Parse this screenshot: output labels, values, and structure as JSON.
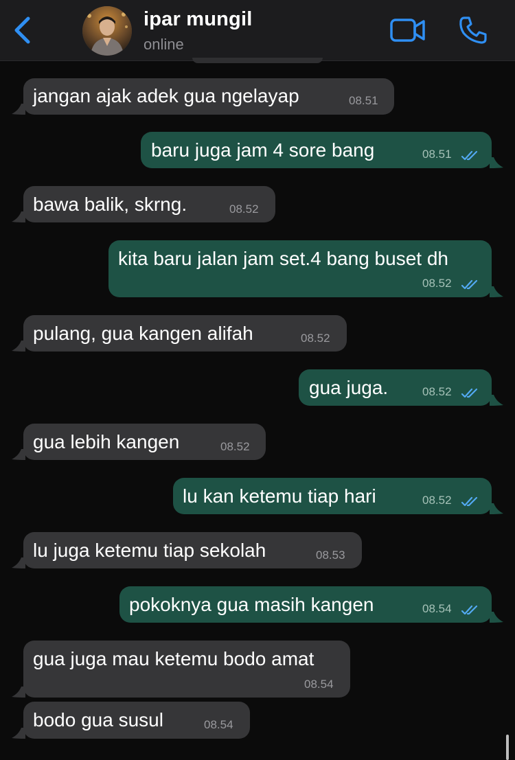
{
  "header": {
    "contact_name": "ipar mungil",
    "status": "online"
  },
  "colors": {
    "accent": "#2f8ff3",
    "incoming_bubble": "#363638",
    "outgoing_bubble": "#1e5245",
    "read_ticks": "#53a9f2"
  },
  "icons": {
    "back": "chevron-left-icon",
    "video": "video-camera-icon",
    "call": "phone-icon",
    "read": "double-check-icon"
  },
  "messages": [
    {
      "direction": "in",
      "text": "jangan ajak adek gua ngelayap",
      "time": "08.51"
    },
    {
      "direction": "out",
      "text": "baru juga jam 4 sore bang",
      "time": "08.51",
      "read": true
    },
    {
      "direction": "in",
      "text": "bawa balik, skrng.",
      "time": "08.52"
    },
    {
      "direction": "out",
      "text": "kita baru jalan jam set.4 bang buset dh",
      "time": "08.52",
      "read": true
    },
    {
      "direction": "in",
      "text": "pulang, gua kangen alifah",
      "time": "08.52"
    },
    {
      "direction": "out",
      "text": "gua juga.",
      "time": "08.52",
      "read": true
    },
    {
      "direction": "in",
      "text": "gua lebih kangen",
      "time": "08.52"
    },
    {
      "direction": "out",
      "text": "lu kan ketemu tiap hari",
      "time": "08.52",
      "read": true
    },
    {
      "direction": "in",
      "text": "lu juga ketemu tiap sekolah",
      "time": "08.53"
    },
    {
      "direction": "out",
      "text": "pokoknya gua masih kangen",
      "time": "08.54",
      "read": true
    },
    {
      "direction": "in",
      "text": "gua juga mau ketemu bodo amat",
      "time": "08.54"
    },
    {
      "direction": "in",
      "text": "bodo gua susul",
      "time": "08.54"
    }
  ]
}
